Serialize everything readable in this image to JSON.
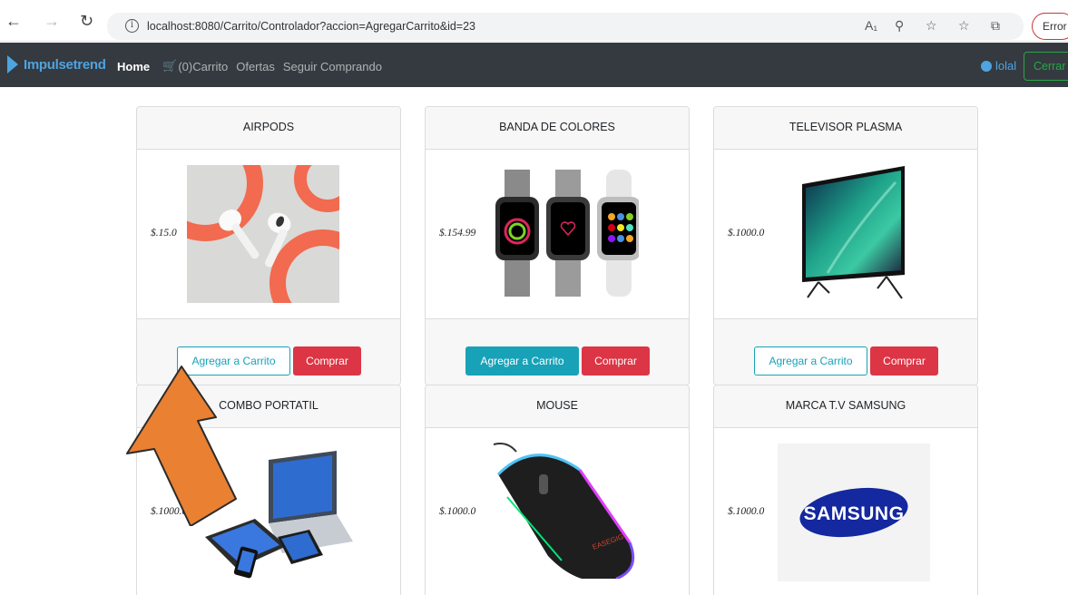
{
  "browser": {
    "url": "localhost:8080/Carrito/Controlador?accion=AgregarCarrito&id=23",
    "error_label": "Error"
  },
  "navbar": {
    "brand": "Impulsetrend",
    "links": {
      "home": "Home",
      "cart_count": "(0)",
      "cart": "Carrito",
      "offers": "Ofertas",
      "continue": "Seguir Comprando"
    },
    "user": "lolal",
    "logout": "Cerrar"
  },
  "products": [
    {
      "name": "AIRPODS",
      "price": "$.15.0"
    },
    {
      "name": "BANDA DE COLORES",
      "price": "$.154.99"
    },
    {
      "name": "TELEVISOR PLASMA",
      "price": "$.1000.0"
    },
    {
      "name": "COMBO PORTATIL",
      "price": "$.1000.0"
    },
    {
      "name": "MOUSE",
      "price": "$.1000.0"
    },
    {
      "name": "MARCA T.V SAMSUNG",
      "price": "$.1000.0"
    }
  ],
  "buttons": {
    "add": "Agregar a Carrito",
    "buy": "Comprar"
  },
  "logos": {
    "samsung": "SAMSUNG"
  },
  "colors": {
    "navbar": "#343a40",
    "info": "#17a2b8",
    "danger": "#dc3545",
    "success": "#28a745",
    "arrow": "#e98032"
  }
}
